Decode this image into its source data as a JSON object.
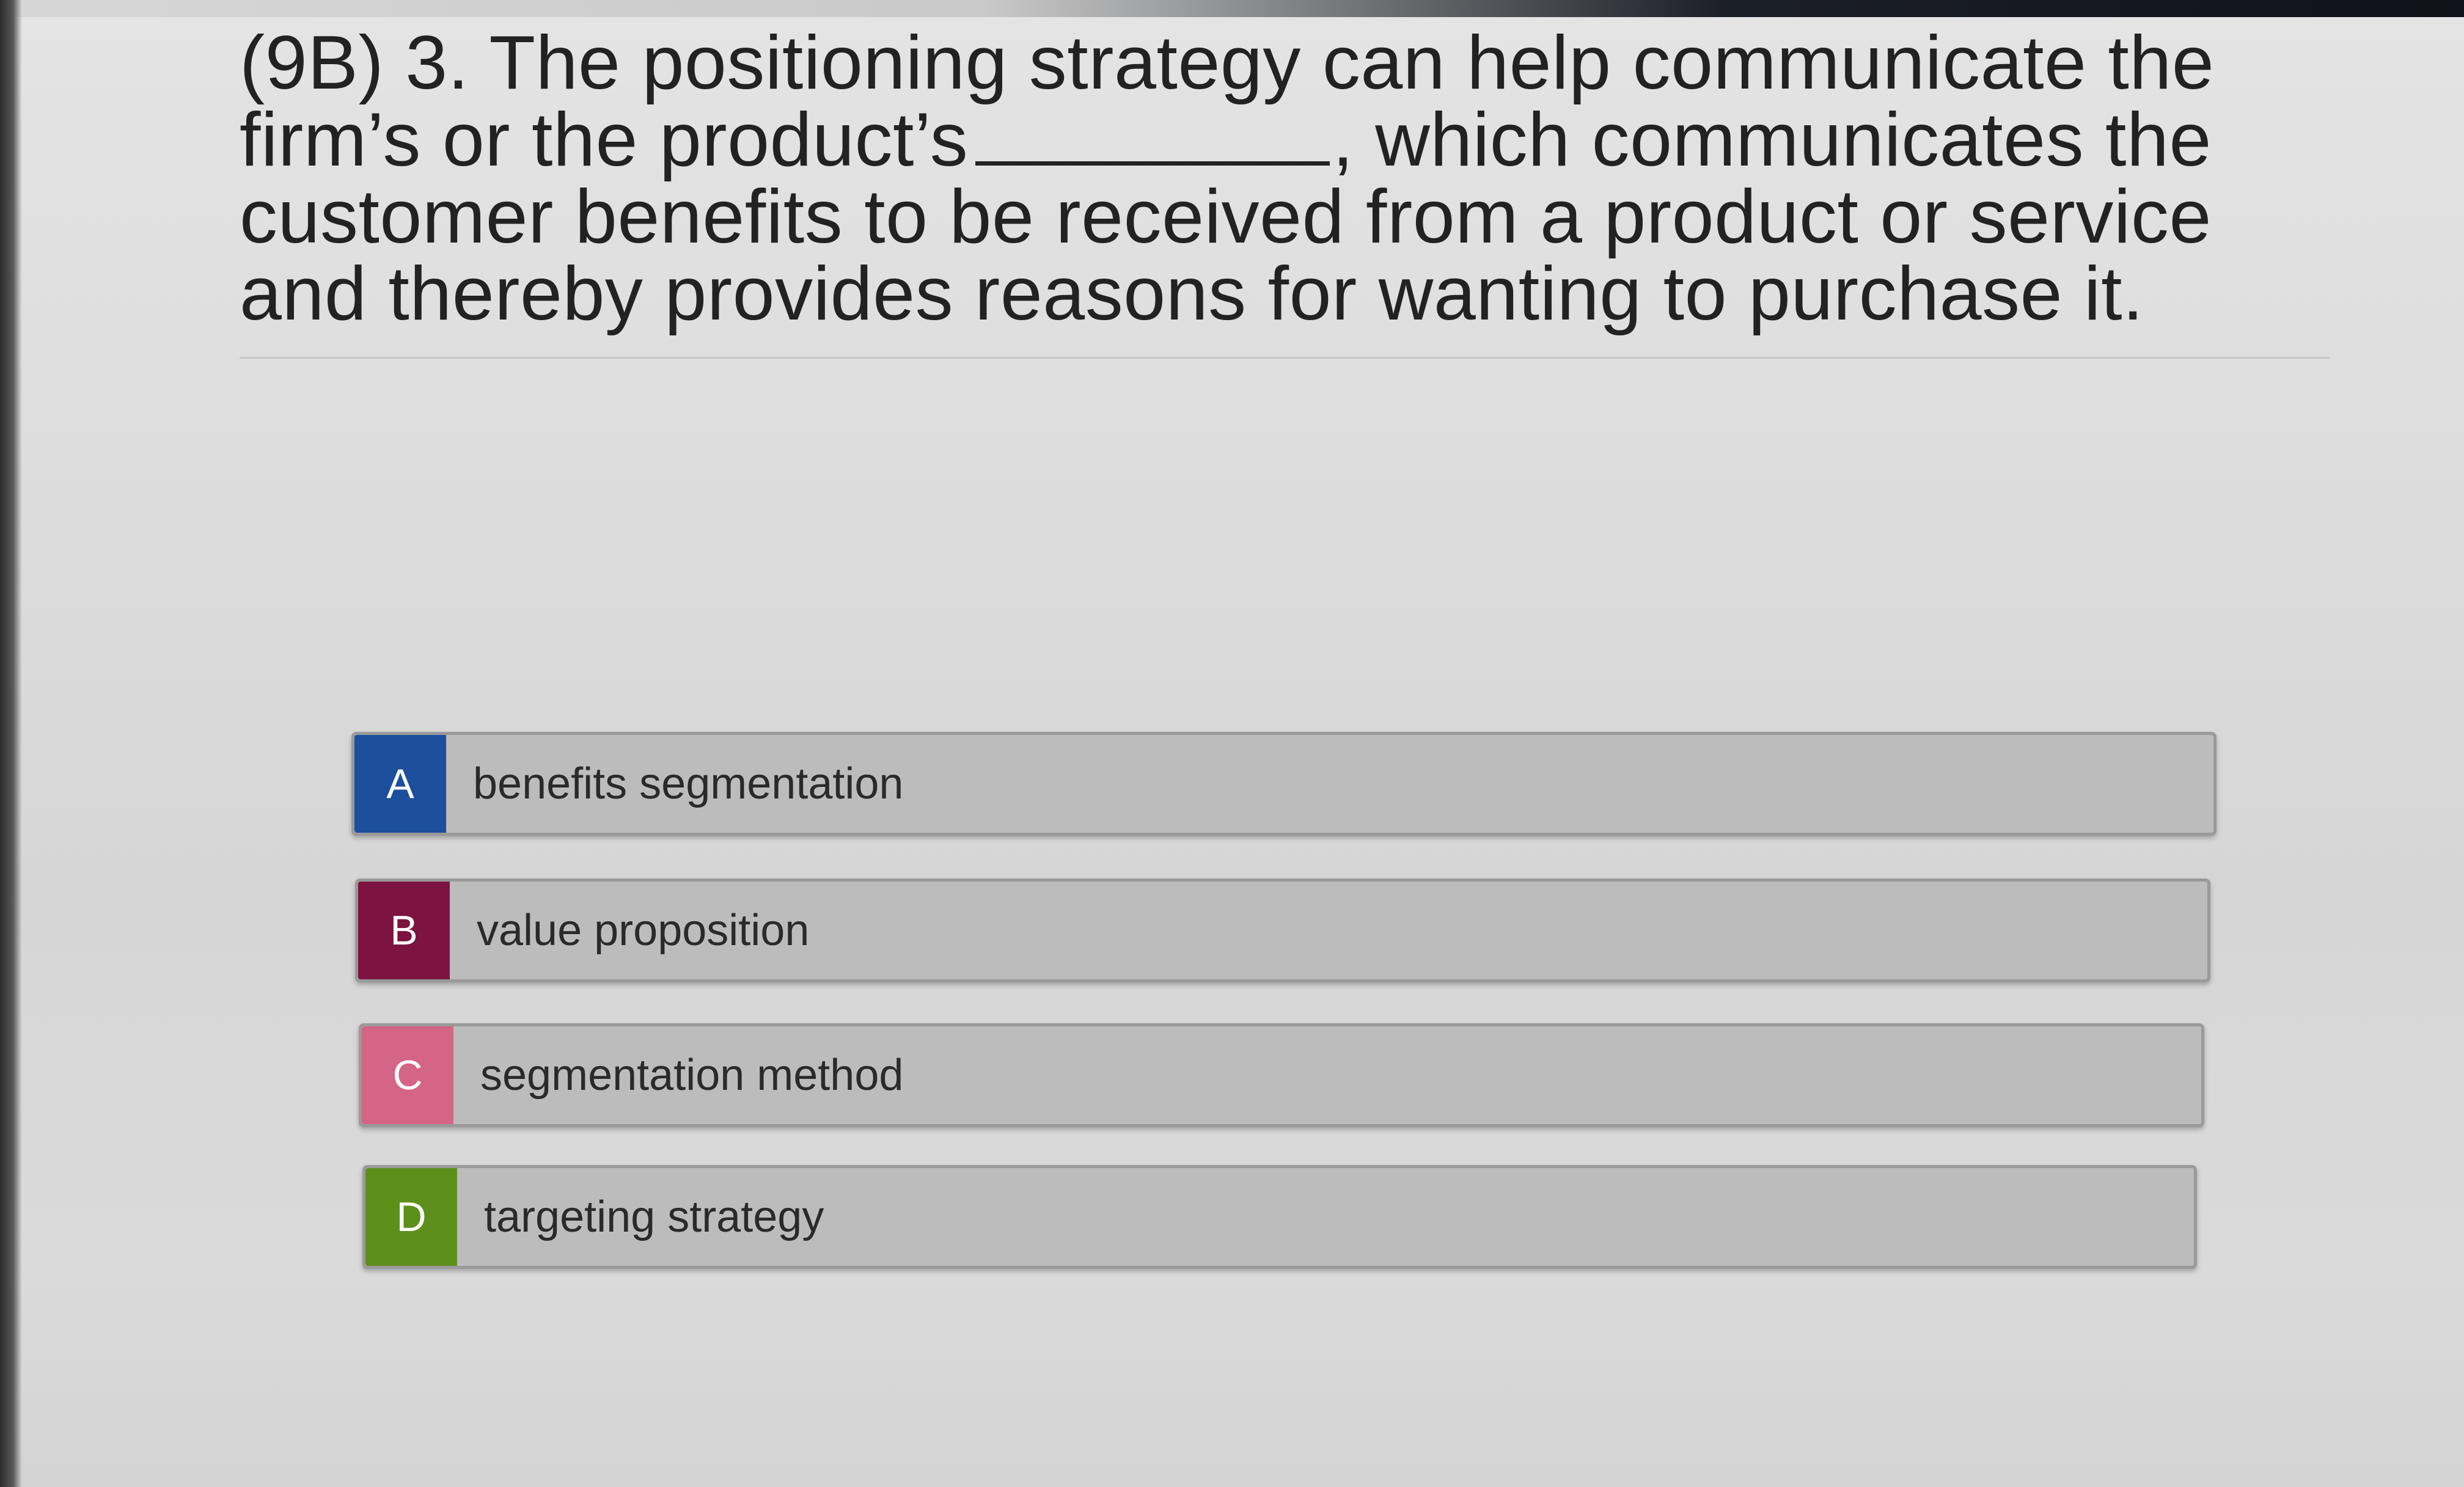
{
  "question": {
    "part1": "(9B) 3. The positioning strategy can help communicate the firm’s or the product’s",
    "part2": ", which communicates the customer benefits to be received from a product or service and thereby provides reasons for wanting to purchase it."
  },
  "options": [
    {
      "letter": "A",
      "label": "benefits segmentation",
      "color": "#1c4f9c"
    },
    {
      "letter": "B",
      "label": "value proposition",
      "color": "#7d1340"
    },
    {
      "letter": "C",
      "label": "segmentation method",
      "color": "#d46586"
    },
    {
      "letter": "D",
      "label": "targeting strategy",
      "color": "#5d8f1b"
    }
  ]
}
